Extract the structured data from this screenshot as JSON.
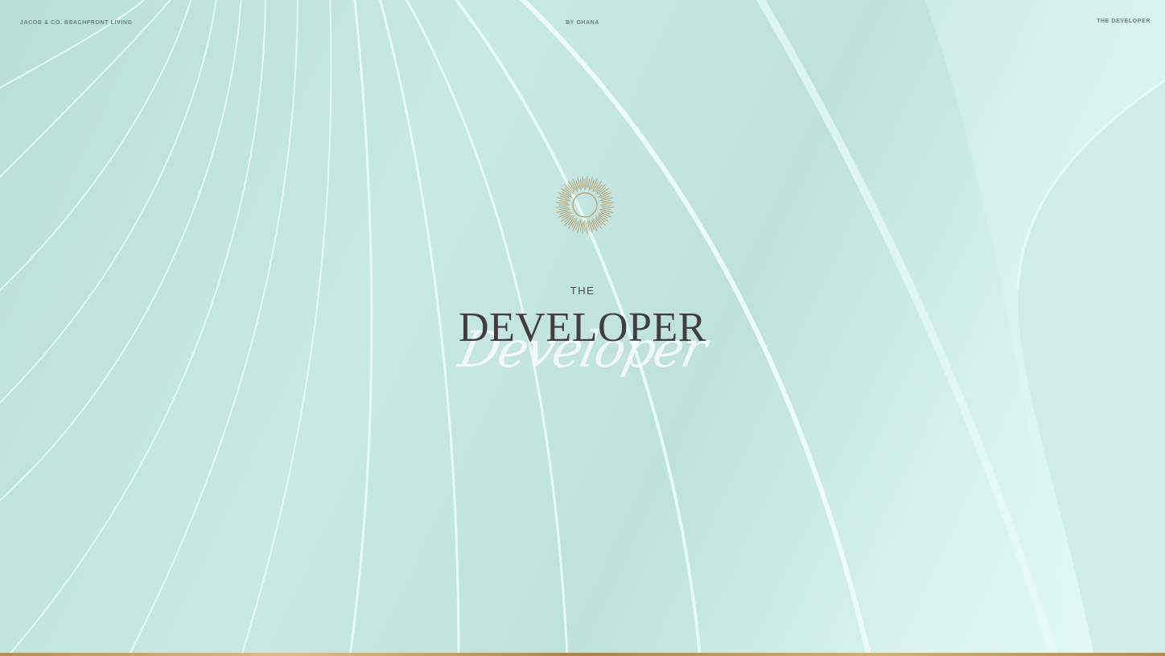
{
  "header": {
    "brand": "JACOB & CO. BEACHFRONT LIVING",
    "tagline": "BY OHANA",
    "nav_current": "THE DEVELOPER"
  },
  "hero": {
    "title_small": "THE",
    "title_large": "DEVELOPER",
    "title_script": "Developer",
    "emblem_icon": "sunburst-icon"
  },
  "colors": {
    "background": "#c6e6e0",
    "text_dark": "#3f3f3d",
    "gold": "#b39a6a"
  }
}
